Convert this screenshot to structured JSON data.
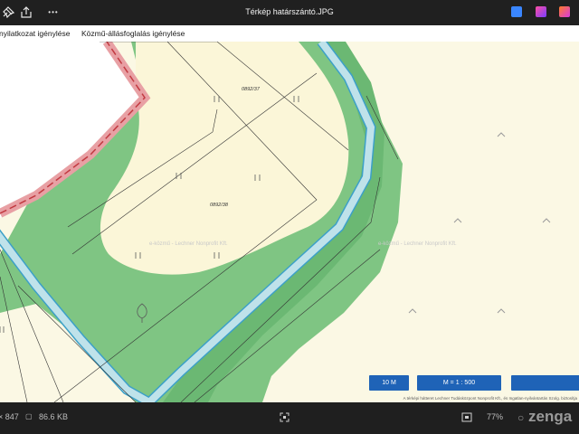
{
  "window": {
    "title": "Térkép határszántó.JPG"
  },
  "toolbar": {
    "share_icon": "share-icon",
    "more_label": "•••"
  },
  "menu": {
    "items": [
      {
        "label": "nyilatkozat igénylése"
      },
      {
        "label": "Közmű-állásfoglalás igénylése"
      }
    ]
  },
  "map": {
    "parcels": [
      {
        "label": "0892/37"
      },
      {
        "label": "0892/38"
      }
    ],
    "watermarks": [
      "e-közmű - Lechner Nonprofit Kft.",
      "e-közmű - Lechner Nonprofit Kft."
    ],
    "buttons": {
      "scale_bar": "10 M",
      "ratio": "M = 1 : 500",
      "extra": ""
    },
    "attribution": "A térképi hátteret Lechner Tudásközpont Nonprofit Kft., és Ingatlan-nyilvántartás Szolg. biztosítja",
    "colors": {
      "background": "#fbf8e4",
      "forest": "#7fc583",
      "parcel_fill": "#fbf6d8",
      "stream": "#bfe2ea",
      "stream_edge": "#3ca0c8",
      "boundary": "#e05055",
      "button": "#1f63b7"
    }
  },
  "status": {
    "dimensions": "× 847",
    "file_size": "86.6 KB",
    "zoom": "77%",
    "watermark": "zenga"
  }
}
